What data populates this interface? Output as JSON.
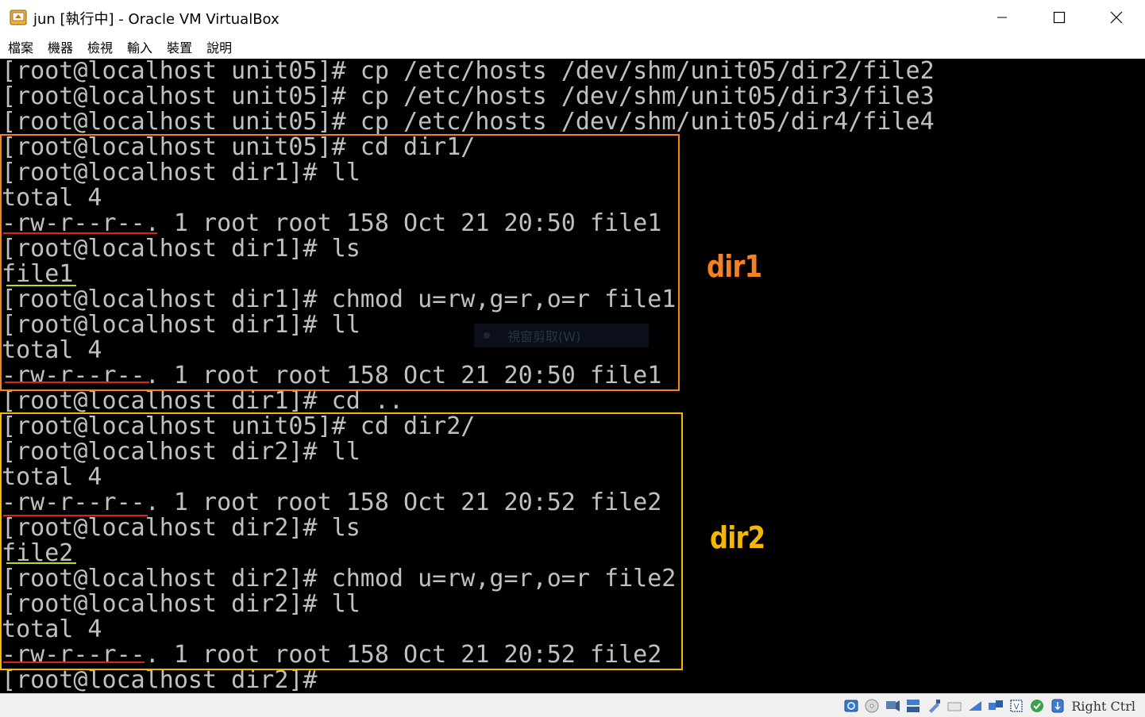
{
  "window": {
    "title": "jun [執行中] - Oracle VM VirtualBox"
  },
  "menu": [
    "檔案",
    "機器",
    "檢視",
    "輸入",
    "裝置",
    "說明"
  ],
  "terminal": {
    "lines": [
      "[root@localhost unit05]# cp /etc/hosts /dev/shm/unit05/dir2/file2",
      "[root@localhost unit05]# cp /etc/hosts /dev/shm/unit05/dir3/file3",
      "[root@localhost unit05]# cp /etc/hosts /dev/shm/unit05/dir4/file4",
      "[root@localhost unit05]# cd dir1/",
      "[root@localhost dir1]# ll",
      "total 4",
      "-rw-r--r--. 1 root root 158 Oct 21 20:50 file1",
      "[root@localhost dir1]# ls",
      "file1",
      "[root@localhost dir1]# chmod u=rw,g=r,o=r file1",
      "[root@localhost dir1]# ll",
      "total 4",
      "-rw-r--r--. 1 root root 158 Oct 21 20:50 file1",
      "[root@localhost dir1]# cd ..",
      "[root@localhost unit05]# cd dir2/",
      "[root@localhost dir2]# ll",
      "total 4",
      "-rw-r--r--. 1 root root 158 Oct 21 20:52 file2",
      "[root@localhost dir2]# ls",
      "file2",
      "[root@localhost dir2]# chmod u=rw,g=r,o=r file2",
      "[root@localhost dir2]# ll",
      "total 4",
      "-rw-r--r--. 1 root root 158 Oct 21 20:52 file2",
      "[root@localhost dir2]#"
    ]
  },
  "annotations": {
    "dir1_label": "dir1",
    "dir2_label": "dir2",
    "dir1_color": "#f5821f",
    "dir2_color": "#f5b800",
    "underline_red": "#e0201c",
    "underline_green": "#b4e01c"
  },
  "context_menu": {
    "item": "視窗剪取(W)"
  },
  "statusbar": {
    "host_key": "Right Ctrl",
    "icons": [
      "hard-disk-icon",
      "optical-drive-icon",
      "audio-icon",
      "network-icon",
      "usb-icon",
      "shared-folders-icon",
      "display-icon",
      "video-capture-icon",
      "cpu-vt-icon",
      "guest-additions-icon",
      "mouse-integration-icon",
      "keyboard-capture-icon"
    ]
  }
}
